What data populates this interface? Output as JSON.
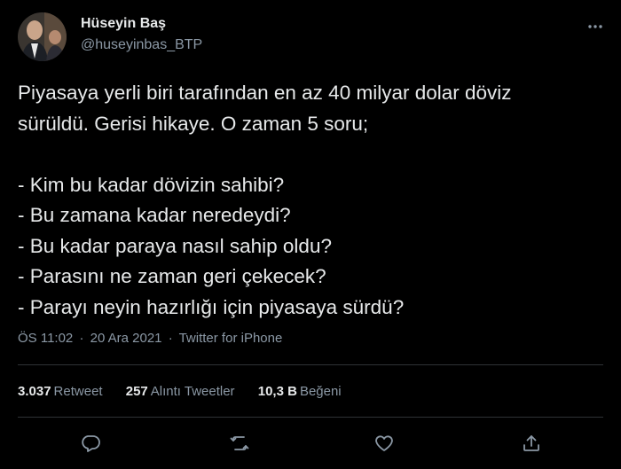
{
  "author": {
    "name": "Hüseyin Baş",
    "handle": "@huseyinbas_BTP",
    "avatar_icon": "profile-photo"
  },
  "menu_icon": "more-icon",
  "tweet": {
    "lines": [
      "Piyasaya yerli biri tarafından en az 40 milyar dolar döviz",
      "sürüldü. Gerisi hikaye. O zaman 5 soru;",
      "",
      "- Kim bu kadar dövizin sahibi?",
      "- Bu zamana kadar neredeydi?",
      "- Bu kadar paraya nasıl sahip oldu?",
      "- Parasını ne zaman geri çekecek?",
      "- Parayı neyin hazırlığı için piyasaya sürdü?"
    ]
  },
  "meta": {
    "time": "ÖS 11:02",
    "date": "20 Ara 2021",
    "source": "Twitter for iPhone",
    "separator": "·"
  },
  "stats": {
    "retweets_count": "3.037",
    "retweets_label": "Retweet",
    "quotes_count": "257",
    "quotes_label": "Alıntı Tweetler",
    "likes_count": "10,3 B",
    "likes_label": "Beğeni"
  },
  "actions": [
    "reply-icon",
    "retweet-icon",
    "like-icon",
    "share-icon"
  ],
  "colors": {
    "background": "#000000",
    "text": "#e7e9ea",
    "secondary": "#8b98a5",
    "divider": "#2f3336"
  }
}
